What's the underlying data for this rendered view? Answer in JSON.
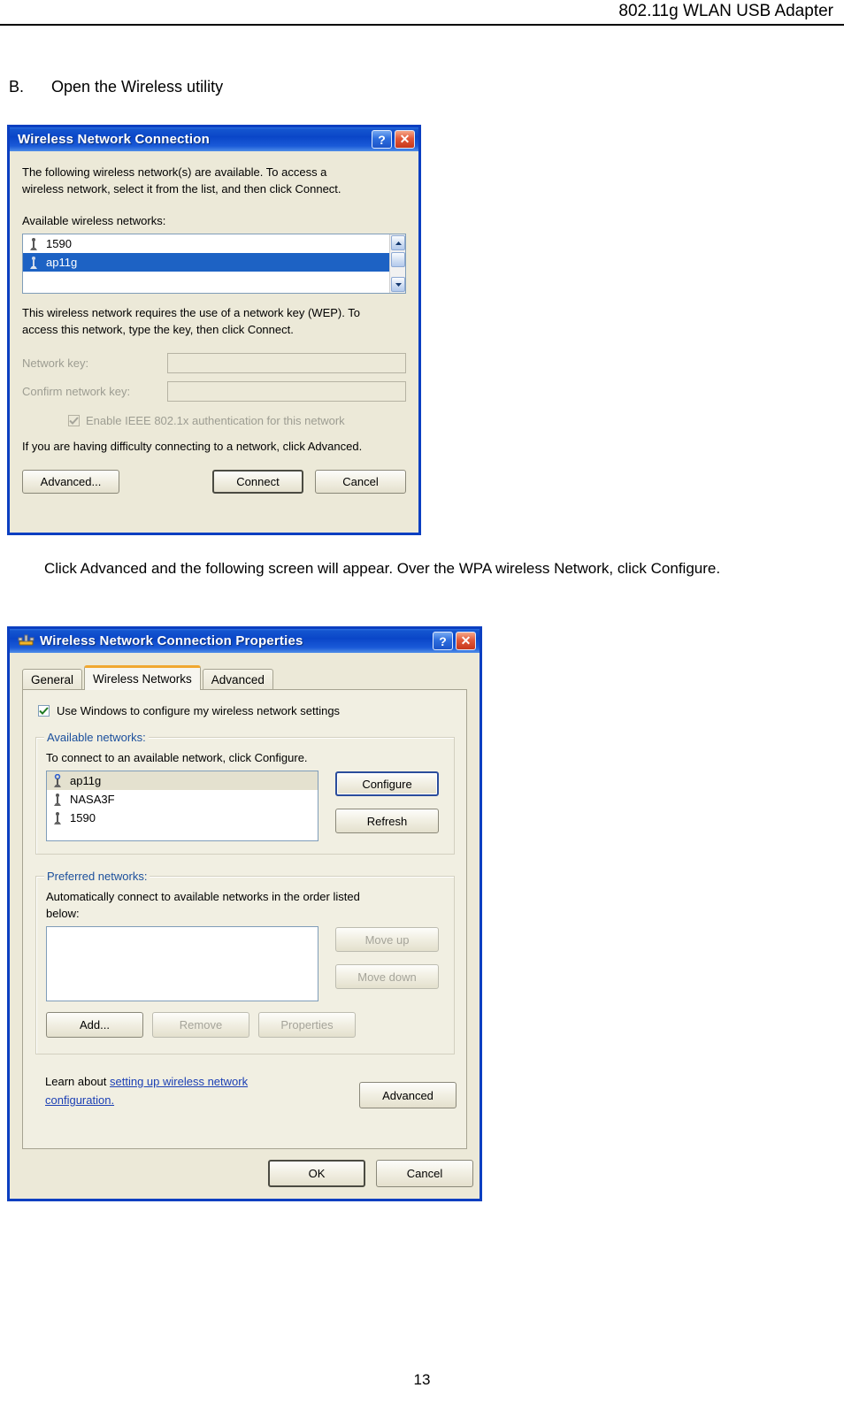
{
  "document": {
    "header_title": "802.11g WLAN USB Adapter",
    "section_label": "B.",
    "section_title": "Open the Wireless utility",
    "paragraph": "Click Advanced and the following screen will appear. Over the WPA wireless Network, click Configure.",
    "page_number": "13"
  },
  "dialog1": {
    "title": "Wireless Network Connection",
    "help_button": "?",
    "close_button": "✕",
    "intro_line1": "The following wireless network(s) are available. To access a",
    "intro_line2": "wireless network, select it from the list, and then click Connect.",
    "available_label": "Available wireless networks:",
    "networks": [
      {
        "name": "1590",
        "icon": "wireless-network-icon",
        "selected": false
      },
      {
        "name": "ap11g",
        "icon": "wireless-network-icon",
        "selected": true
      }
    ],
    "wep_line1": "This wireless network requires the use of a network key (WEP). To",
    "wep_line2": "access this network, type the key, then click Connect.",
    "network_key_label": "Network key:",
    "network_key_value": "",
    "confirm_key_label": "Confirm network key:",
    "confirm_key_value": "",
    "enable_8021x_label": "Enable IEEE 802.1x authentication for this network",
    "enable_8021x_checked": true,
    "difficulty_text": "If you are having difficulty connecting to a network, click Advanced.",
    "buttons": {
      "advanced": "Advanced...",
      "connect": "Connect",
      "cancel": "Cancel"
    }
  },
  "dialog2": {
    "title": "Wireless Network Connection Properties",
    "help_button": "?",
    "close_button": "✕",
    "tabs": [
      {
        "label": "General",
        "active": false
      },
      {
        "label": "Wireless Networks",
        "active": true
      },
      {
        "label": "Advanced",
        "active": false
      }
    ],
    "use_windows_label": "Use Windows to configure my wireless network settings",
    "use_windows_checked": true,
    "available_group": {
      "title": "Available networks:",
      "hint": "To connect to an available network, click Configure.",
      "networks": [
        {
          "name": "ap11g",
          "icon": "secured-wireless-network-icon",
          "selected": true
        },
        {
          "name": "NASA3F",
          "icon": "wireless-network-icon",
          "selected": false
        },
        {
          "name": "1590",
          "icon": "wireless-network-icon",
          "selected": false
        }
      ],
      "configure_button": "Configure",
      "refresh_button": "Refresh"
    },
    "preferred_group": {
      "title": "Preferred networks:",
      "hint_line1": "Automatically connect to available networks in the order listed",
      "hint_line2": "below:",
      "networks": [],
      "move_up_button": "Move up",
      "move_down_button": "Move down",
      "add_button": "Add...",
      "remove_button": "Remove",
      "properties_button": "Properties"
    },
    "learn_prefix": "Learn about ",
    "learn_link_line1": "setting up wireless network",
    "learn_link_line2": "configuration.",
    "advanced_button": "Advanced",
    "ok_button": "OK",
    "cancel_button": "Cancel"
  },
  "colors": {
    "title_bar_blue": "#0a46c8",
    "dialog_face": "#ece9d8",
    "selection_blue": "#1d62c4",
    "active_tab_orange": "#f0a830",
    "link_blue": "#1b3fb4"
  }
}
